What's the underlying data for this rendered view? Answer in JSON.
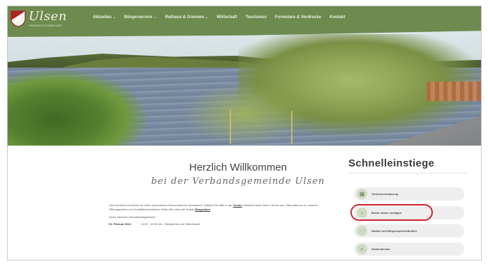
{
  "header": {
    "logo_title": "Ulsen",
    "logo_subtitle": "VERBANDSGEMEINDE",
    "nav": [
      {
        "label": "Aktuelles",
        "has_dropdown": true
      },
      {
        "label": "Bürgerservice",
        "has_dropdown": true
      },
      {
        "label": "Rathaus & Gremien",
        "has_dropdown": true
      },
      {
        "label": "Wirtschaft",
        "has_dropdown": false
      },
      {
        "label": "Tourismus",
        "has_dropdown": false
      },
      {
        "label": "Formulare & Vordrucke",
        "has_dropdown": false
      },
      {
        "label": "Kontakt",
        "has_dropdown": false
      }
    ],
    "dropdown_chevron": "⌄"
  },
  "welcome": {
    "title": "Herzlich Willkommen",
    "subtitle": "bei der Verbandsgemeinde Ulsen",
    "paragraph_pre": "Jetzt schnell und einfach Ihr einen persönlichen Besuchstermin vereinbaren. Wählen Sie bitte in der",
    "paragraph_link": "Termin",
    "paragraph_post": "Übersicht einen freien Termin aus. Informationen zu unseren Öffnungszeiten und Kontaktinformationen finden Sie unter der Rubrik",
    "paragraph_link2": "Bürgerbüro",
    "note": "Unser nächster Dienstleistungstermin:",
    "date": "01. Februar 2024",
    "time_info": "10:00 - 12:00 Uhr - Bürgerbüro und Standesamt"
  },
  "quicklinks": {
    "title": "Schnelleinstiege",
    "items": [
      {
        "label": "Terminvereinbarung",
        "icon": "calendar-icon",
        "glyph": "▦"
      },
      {
        "label": "Briefe online erledigen",
        "icon": "chevron-right-icon",
        "glyph": "›"
      },
      {
        "label": "Hotline und Bürgersprechstunden",
        "icon": "chat-icon",
        "glyph": "◌"
      },
      {
        "label": "Onlinedienste",
        "icon": "search-icon",
        "glyph": "⌕"
      }
    ]
  },
  "colors": {
    "nav_green": "#6d8a4f",
    "highlight_red": "#d0202a",
    "quick_bg": "#eeeeee"
  }
}
